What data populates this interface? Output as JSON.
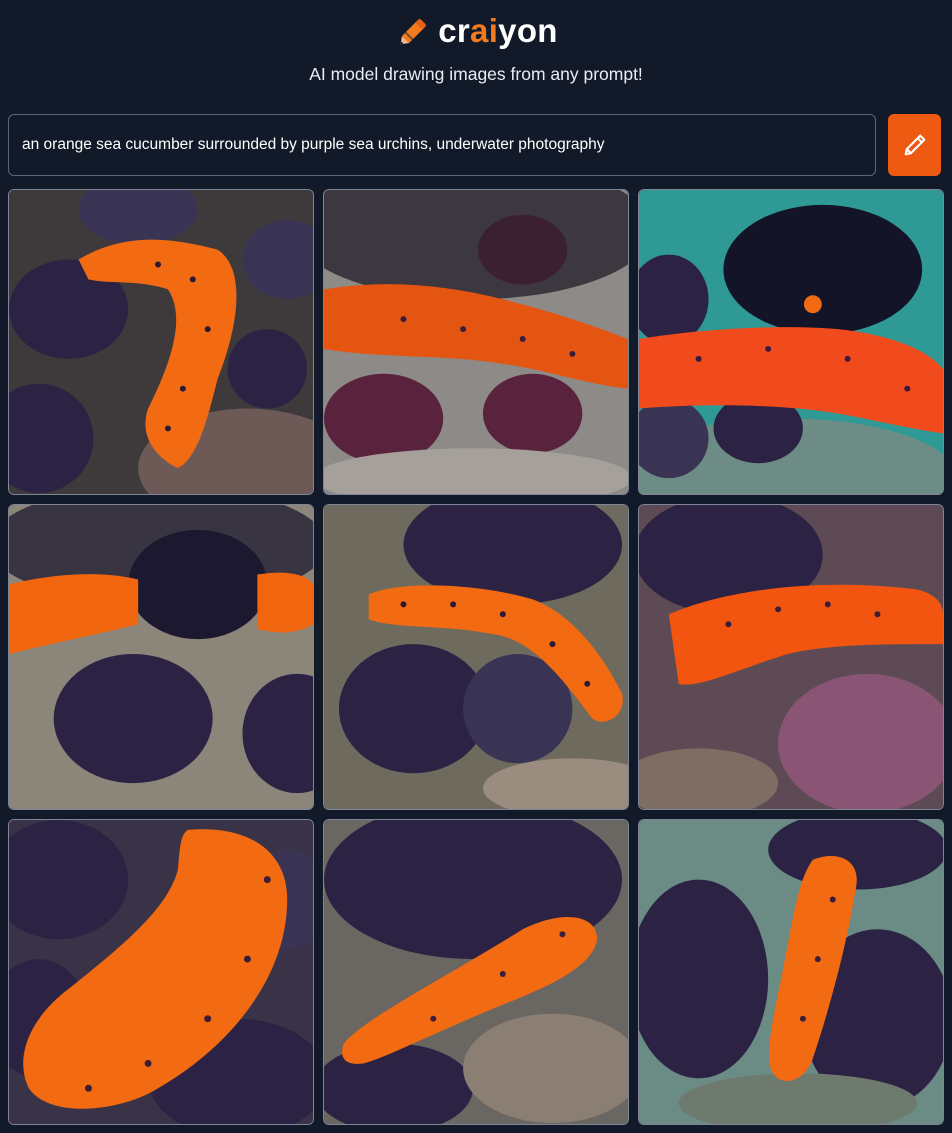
{
  "brand": {
    "name_pre": "cr",
    "name_accent": "ai",
    "name_post": "yon",
    "accent_color": "#f47a20"
  },
  "tagline": "AI model drawing images from any prompt!",
  "prompt": {
    "value": "an orange sea cucumber surrounded by purple sea urchins, underwater photography"
  },
  "draw_button": {
    "icon": "pencil-icon",
    "color": "#ee5a12"
  },
  "colors": {
    "background": "#121a29",
    "cucumber_orange": "#f26a12",
    "urchin_purple": "#2c2344"
  },
  "gallery": {
    "count": 9,
    "content": "orange sea cucumber with purple sea urchins"
  }
}
